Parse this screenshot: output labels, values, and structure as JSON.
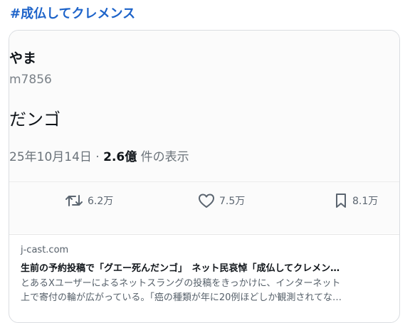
{
  "hashtag": "#成仏してクレメンス",
  "post": {
    "user_name": "やま",
    "user_handle": "m7856",
    "text": "だンゴ",
    "date": "25年10月14日 · ",
    "views_count": "2.6億",
    "views_suffix": " 件の表示"
  },
  "stats": {
    "retweets": "6.2万",
    "likes": "7.5万",
    "bookmarks": "8.1万"
  },
  "link_card": {
    "domain": "j-cast.com",
    "headline": "生前の予約投稿で「グエー死んだンゴ」　ネット民哀悼「成仏してクレメン…",
    "description_line1": "とあるXユーザーによるネットスラングの投稿をきっかけに、インターネット",
    "description_line2": "上で寄付の輪が広がっている。「癌の種類が年に20例ほどしか観測されてな…"
  },
  "colors": {
    "hashtag": "#1d63c9",
    "icon": "#5b6570"
  }
}
